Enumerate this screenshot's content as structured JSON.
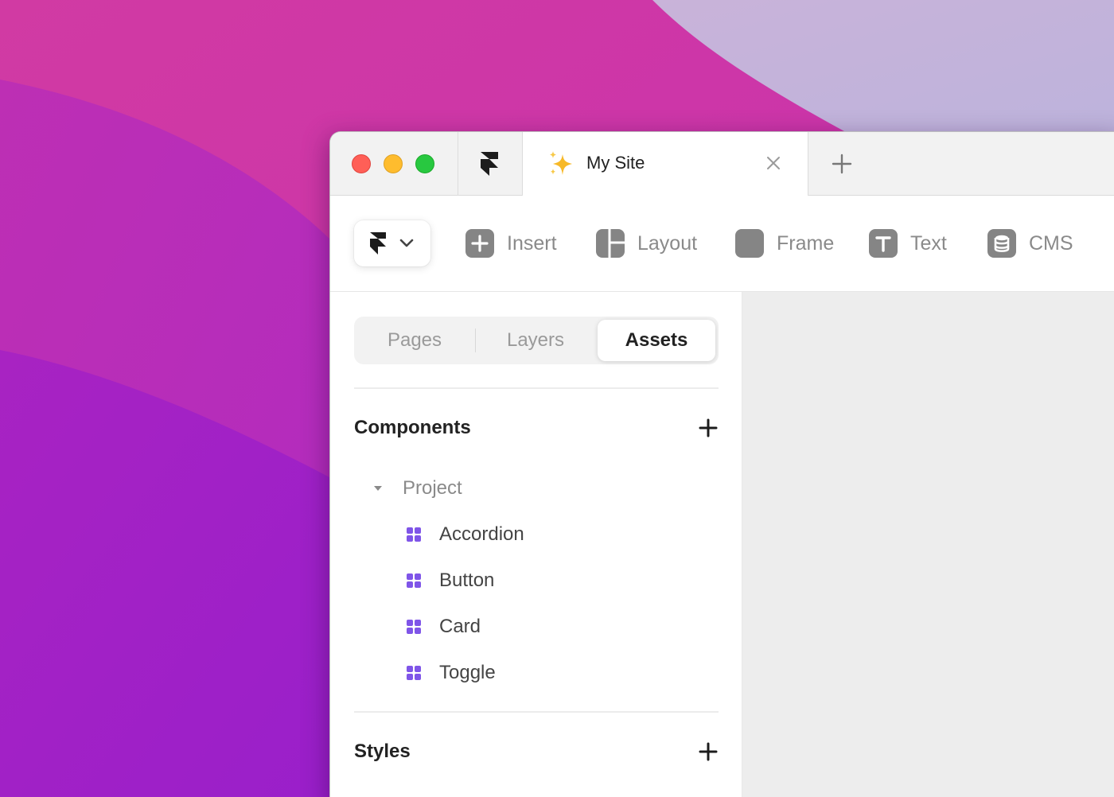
{
  "window": {
    "tabs": [
      {
        "title": "My Site",
        "active": true
      }
    ]
  },
  "toolbar": {
    "tools": [
      {
        "id": "insert",
        "label": "Insert",
        "icon": "plus-square-icon"
      },
      {
        "id": "layout",
        "label": "Layout",
        "icon": "layout-icon"
      },
      {
        "id": "frame",
        "label": "Frame",
        "icon": "frame-icon"
      },
      {
        "id": "text",
        "label": "Text",
        "icon": "text-icon"
      },
      {
        "id": "cms",
        "label": "CMS",
        "icon": "database-icon"
      }
    ]
  },
  "sidebar": {
    "tabs": [
      {
        "label": "Pages",
        "selected": false
      },
      {
        "label": "Layers",
        "selected": false
      },
      {
        "label": "Assets",
        "selected": true
      }
    ],
    "components": {
      "title": "Components",
      "folder": "Project",
      "items": [
        "Accordion",
        "Button",
        "Card",
        "Toggle"
      ]
    },
    "styles": {
      "title": "Styles"
    }
  },
  "colors": {
    "component_icon": "#7f55e8",
    "traffic_red": "#ff5f57",
    "traffic_yellow": "#febc2e",
    "traffic_green": "#28c840",
    "sparkle": "#f7b928"
  }
}
